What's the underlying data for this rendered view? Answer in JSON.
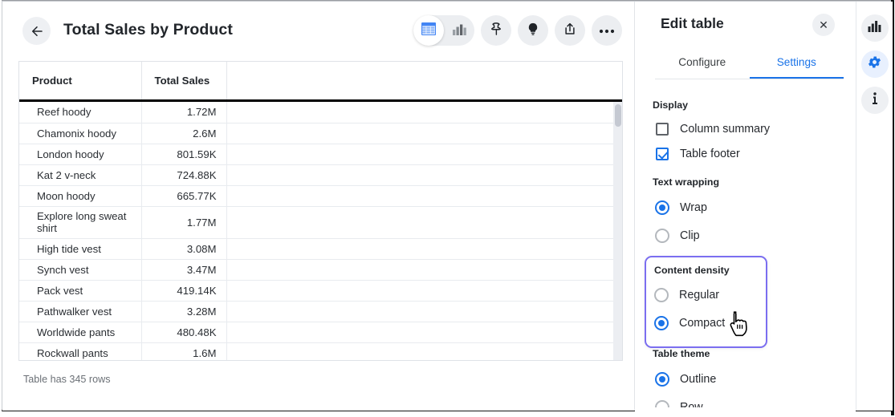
{
  "window": {
    "title": "Total Sales by Product"
  },
  "main": {
    "back_icon": "arrow-left-icon",
    "toolbar": {
      "view_table_icon": "table-view-icon",
      "view_chart_icon": "bar-chart-view-icon",
      "pin_icon": "pin-icon",
      "insight_icon": "lightbulb-icon",
      "share_icon": "share-upload-icon",
      "more_icon": "more-horizontal-icon"
    },
    "table": {
      "columns": [
        "Product",
        "Total Sales",
        ""
      ],
      "rows": [
        {
          "product": "Reef hoody",
          "total_sales": "1.72M"
        },
        {
          "product": "Chamonix hoody",
          "total_sales": "2.6M"
        },
        {
          "product": "London hoody",
          "total_sales": "801.59K"
        },
        {
          "product": "Kat 2 v-neck",
          "total_sales": "724.88K"
        },
        {
          "product": "Moon hoody",
          "total_sales": "665.77K"
        },
        {
          "product": "Explore long sweat shirt",
          "total_sales": "1.77M"
        },
        {
          "product": "High tide vest",
          "total_sales": "3.08M"
        },
        {
          "product": "Synch vest",
          "total_sales": "3.47M"
        },
        {
          "product": "Pack vest",
          "total_sales": "419.14K"
        },
        {
          "product": "Pathwalker vest",
          "total_sales": "3.28M"
        },
        {
          "product": "Worldwide pants",
          "total_sales": "480.48K"
        },
        {
          "product": "Rockwall pants",
          "total_sales": "1.6M"
        }
      ],
      "footnote": "Table has 345 rows"
    }
  },
  "panel": {
    "title": "Edit table",
    "close_label": "✕",
    "tabs": [
      {
        "label": "Configure",
        "active": false
      },
      {
        "label": "Settings",
        "active": true
      }
    ],
    "sections": {
      "display": {
        "label": "Display",
        "options": [
          {
            "label": "Column summary",
            "checked": false
          },
          {
            "label": "Table footer",
            "checked": true
          }
        ]
      },
      "text_wrapping": {
        "label": "Text wrapping",
        "options": [
          {
            "label": "Wrap",
            "selected": true
          },
          {
            "label": "Clip",
            "selected": false
          }
        ]
      },
      "content_density": {
        "label": "Content density",
        "highlighted": true,
        "highlight_color": "#7b6ef0",
        "options": [
          {
            "label": "Regular",
            "selected": false
          },
          {
            "label": "Compact",
            "selected": true
          }
        ]
      },
      "table_theme": {
        "label": "Table theme",
        "options": [
          {
            "label": "Outline",
            "selected": true
          },
          {
            "label": "Row",
            "selected": false
          }
        ]
      }
    }
  },
  "rail": {
    "buttons": [
      {
        "icon": "bar-chart-icon",
        "active": false
      },
      {
        "icon": "gear-icon",
        "active": true
      },
      {
        "icon": "info-icon",
        "active": false
      }
    ]
  },
  "colors": {
    "accent_blue": "#1a73e8",
    "highlight_purple": "#7b6ef0",
    "text_primary": "#22262b",
    "text_muted": "#6b7076",
    "chip_bg": "#eef0f3"
  },
  "cursor": {
    "type": "pointing-hand"
  }
}
